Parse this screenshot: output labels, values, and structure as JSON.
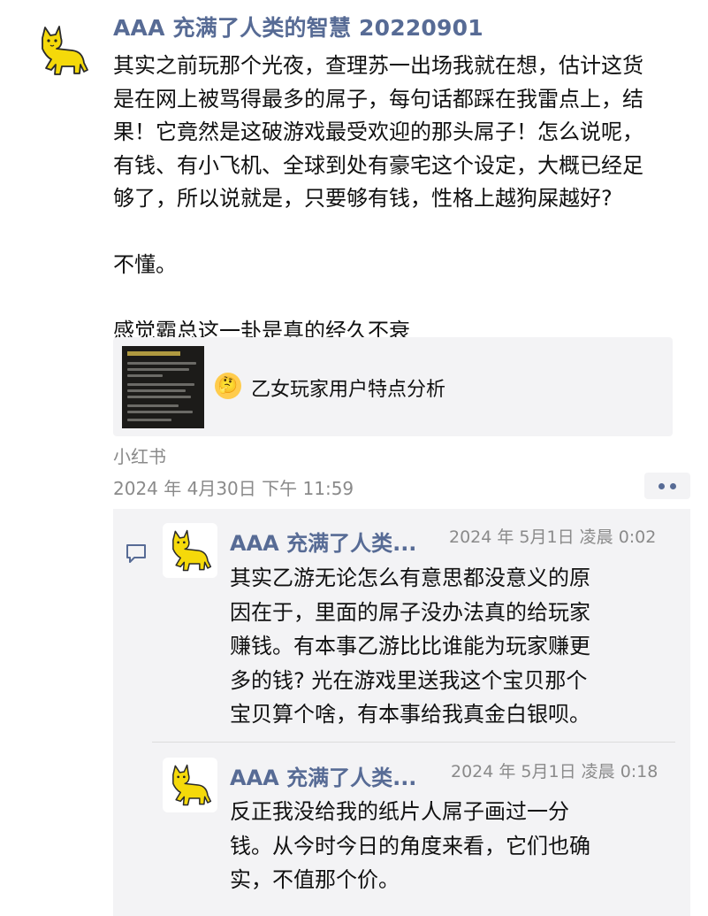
{
  "post": {
    "author": "AAA 充满了人类的智慧 20220901",
    "avatar_icon": "yellow-cat-icon",
    "body_lines": [
      "其实之前玩那个光夜，查理苏一出场我就在想，估计这货",
      "是在网上被骂得最多的屌子，每句话都踩在我雷点上，结",
      "果！它竟然是这破游戏最受欢迎的那头屌子！怎么说呢，",
      "有钱、有小飞机、全球到处有豪宅这个设定，大概已经足",
      "够了，所以说就是，只要够有钱，性格上越狗屎越好?"
    ],
    "paragraph_2": "不懂。",
    "paragraph_3": "感觉霸总这一卦是真的经久不衰",
    "link_card": {
      "emoji": "🤔",
      "title": "乙女玩家用户特点分析"
    },
    "source": "小红书",
    "timestamp": "2024 年 4月30日 下午 11:59"
  },
  "comments": [
    {
      "author": "AAA 充满了人类...",
      "time": "2024 年 5月1日 凌晨 0:02",
      "lines": [
        "其实乙游无论怎么有意思都没意义的原",
        "因在于，里面的屌子没办法真的给玩家",
        "赚钱。有本事乙游比比谁能为玩家赚更",
        "多的钱? 光在游戏里送我这个宝贝那个",
        "宝贝算个啥，有本事给我真金白银呗。"
      ]
    },
    {
      "author": "AAA 充满了人类...",
      "time": "2024 年 5月1日 凌晨 0:18",
      "lines": [
        "反正我没给我的纸片人屌子画过一分",
        "钱。从今时今日的角度来看，它们也确",
        "实，不值那个价。"
      ]
    }
  ],
  "colors": {
    "name_link": "#576b95",
    "secondary_text": "#8a8a8a",
    "panel_bg": "#f3f3f5",
    "cat_yellow": "#f5d90a"
  }
}
